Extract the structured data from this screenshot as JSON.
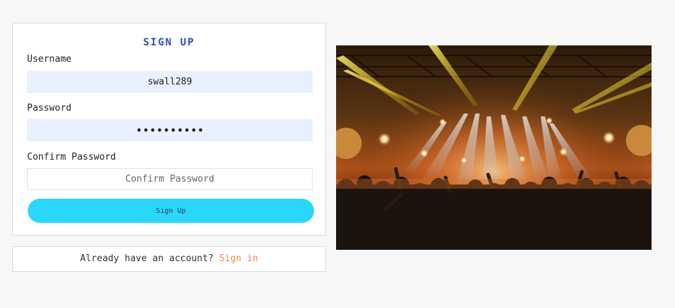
{
  "signup": {
    "title": "SIGN UP",
    "username_label": "Username",
    "username_value": "swall289",
    "password_label": "Password",
    "password_value": "••••••••••",
    "confirm_label": "Confirm Password",
    "confirm_placeholder": "Confirm Password",
    "submit_label": "Sign Up"
  },
  "signin": {
    "prompt": "Already have an account?",
    "link_label": "Sign in"
  },
  "photo": {
    "subject": "concert-crowd-stage-lights"
  },
  "colors": {
    "background": "#f7f7f7",
    "title": "#2e4cbd",
    "filled_input": "#e8f0fe",
    "button": "#2bd6fb",
    "link": "#f08a4b"
  }
}
